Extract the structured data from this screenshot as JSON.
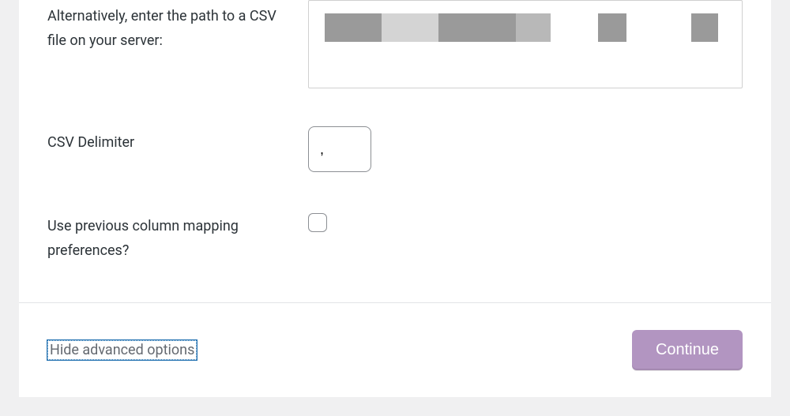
{
  "form": {
    "csv_path": {
      "label": "Alternatively, enter the path to a CSV file on your server:",
      "value": ""
    },
    "delimiter": {
      "label": "CSV Delimiter",
      "value": ","
    },
    "use_previous_mapping": {
      "label": "Use previous column mapping preferences?",
      "checked": false
    }
  },
  "footer": {
    "toggle_label": "Hide advanced options",
    "continue_label": "Continue"
  }
}
